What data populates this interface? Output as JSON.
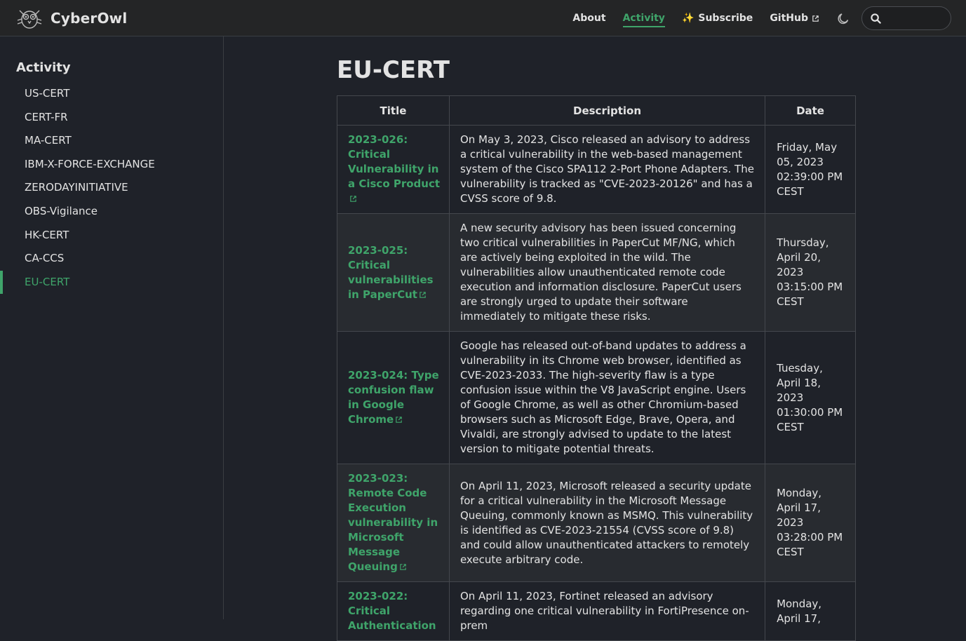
{
  "brand": {
    "name": "CyberOwl"
  },
  "nav": {
    "links": [
      {
        "label": "About"
      },
      {
        "label": "Activity"
      },
      {
        "label": "Subscribe"
      },
      {
        "label": "GitHub"
      }
    ],
    "search_placeholder": ""
  },
  "sidebar": {
    "title": "Activity",
    "items": [
      {
        "label": "US-CERT"
      },
      {
        "label": "CERT-FR"
      },
      {
        "label": "MA-CERT"
      },
      {
        "label": "IBM-X-FORCE-EXCHANGE"
      },
      {
        "label": "ZERODAYINITIATIVE"
      },
      {
        "label": "OBS-Vigilance"
      },
      {
        "label": "HK-CERT"
      },
      {
        "label": "CA-CCS"
      },
      {
        "label": "EU-CERT"
      }
    ]
  },
  "main": {
    "title": "EU-CERT",
    "table": {
      "headers": [
        "Title",
        "Description",
        "Date"
      ],
      "rows": [
        {
          "title": "2023-026: Critical Vulnerability in a Cisco Product",
          "description": "On May 3, 2023, Cisco released an advisory to address a critical vulnerability in the web-based management system of the Cisco SPA112 2-Port Phone Adapters. The vulnerability is tracked as \"CVE-2023-20126\" and has a CVSS score of 9.8.",
          "date": "Friday, May 05, 2023 02:39:00 PM CEST"
        },
        {
          "title": "2023-025: Critical vulnerabilities in PaperCut",
          "description": "A new security advisory has been issued concerning two critical vulnerabilities in PaperCut MF/NG, which are actively being exploited in the wild. The vulnerabilities allow unauthenticated remote code execution and information disclosure. PaperCut users are strongly urged to update their software immediately to mitigate these risks.",
          "date": "Thursday, April 20, 2023 03:15:00 PM CEST"
        },
        {
          "title": "2023-024: Type confusion flaw in Google Chrome",
          "description": "Google has released out-of-band updates to address a vulnerability in its Chrome web browser, identified as CVE-2023-2033. The high-severity flaw is a type confusion issue within the V8 JavaScript engine. Users of Google Chrome, as well as other Chromium-based browsers such as Microsoft Edge, Brave, Opera, and Vivaldi, are strongly advised to update to the latest version to mitigate potential threats.",
          "date": "Tuesday, April 18, 2023 01:30:00 PM CEST"
        },
        {
          "title": "2023-023: Remote Code Execution vulnerability in Microsoft Message Queuing",
          "description": "On April 11, 2023, Microsoft released a security update for a critical vulnerability in the Microsoft Message Queuing, commonly known as MSMQ. This vulnerability is identified as CVE-2023-21554 (CVSS score of 9.8) and could allow unauthenticated attackers to remotely execute arbitrary code.",
          "date": "Monday, April 17, 2023 03:28:00 PM CEST"
        },
        {
          "title": "2023-022: Critical Authentication",
          "description": "On April 11, 2023, Fortinet released an advisory regarding one critical vulnerability in FortiPresence on-prem",
          "date": "Monday, April 17,"
        }
      ]
    }
  },
  "colors": {
    "accent": "#3fa46a",
    "background": "#1f2229",
    "navbar": "#242526"
  }
}
